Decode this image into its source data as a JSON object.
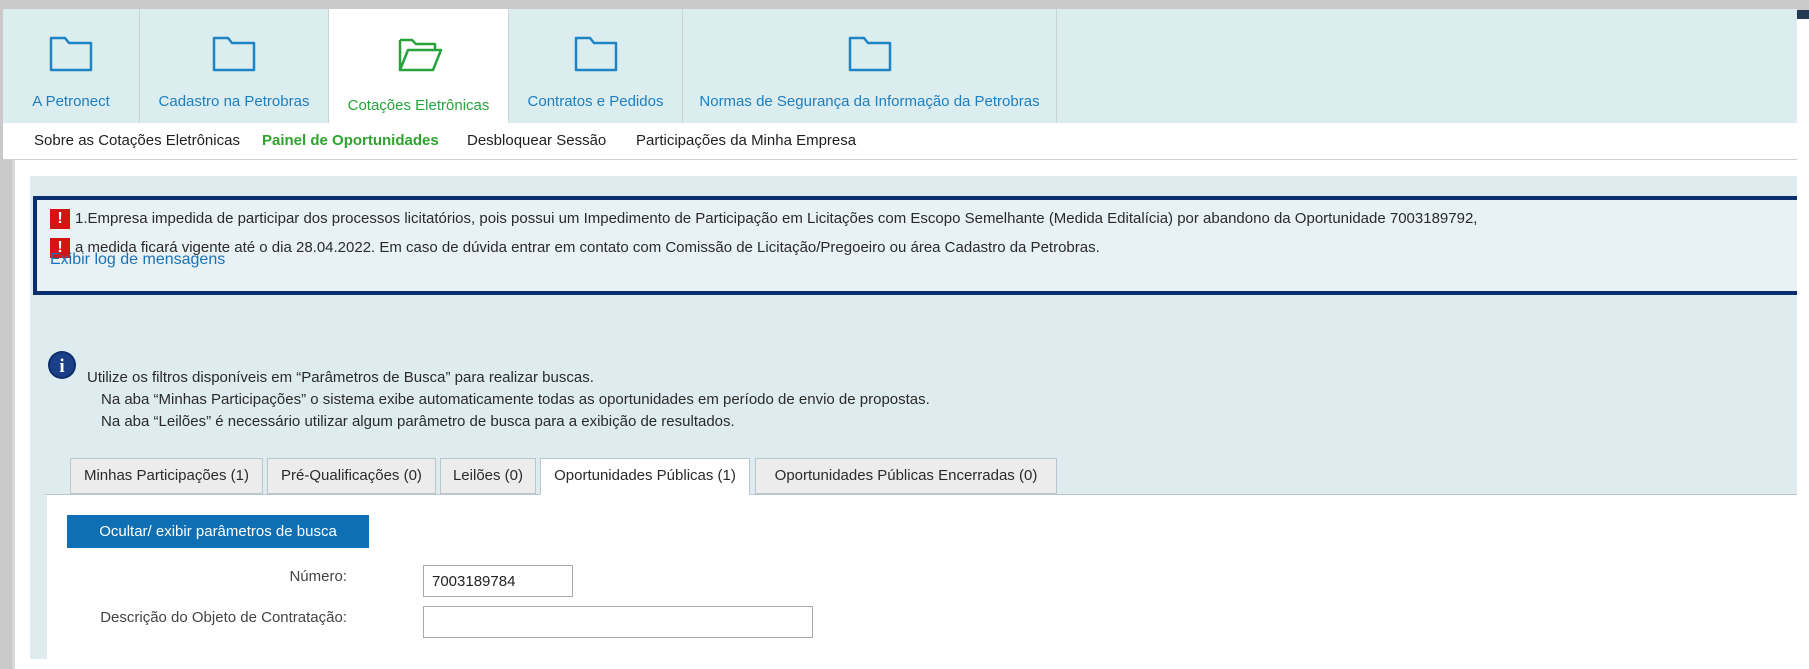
{
  "main_tabs": [
    {
      "label": "A Petronect",
      "icon": "folder-icon"
    },
    {
      "label": "Cadastro na Petrobras",
      "icon": "folder-icon"
    },
    {
      "label": "Cotações Eletrônicas",
      "icon": "folder-open-icon"
    },
    {
      "label": "Contratos e Pedidos",
      "icon": "folder-icon"
    },
    {
      "label": "Normas de Segurança da Informação da Petrobras",
      "icon": "folder-icon"
    }
  ],
  "sub_nav": [
    {
      "label": "Sobre as Cotações Eletrônicas"
    },
    {
      "label": "Painel de Oportunidades"
    },
    {
      "label": "Desbloquear Sessão"
    },
    {
      "label": "Participações da Minha Empresa"
    }
  ],
  "messages": {
    "lines": [
      "1.Empresa impedida de participar dos processos licitatórios, pois possui um Impedimento de Participação em Licitações com Escopo Semelhante (Medida Editalícia) por abandono da Oportunidade 7003189792,",
      "a medida ficará vigente até o dia 28.04.2022. Em caso de dúvida entrar em contato com Comissão de Licitação/Pregoeiro ou área Cadastro da Petrobras."
    ],
    "log_link": "Exibir log de mensagens",
    "error_glyph": "!"
  },
  "info": {
    "icon_glyph": "i",
    "lines": [
      "Utilize os filtros disponíveis em “Parâmetros de Busca” para realizar buscas.",
      "Na aba “Minhas Participações” o sistema exibe automaticamente todas as oportunidades em período de envio de propostas.",
      "Na aba “Leilões” é necessário utilizar algum parâmetro de busca para a exibição de resultados."
    ]
  },
  "inner_tabs": [
    {
      "label": "Minhas Participações (1)"
    },
    {
      "label": "Pré-Qualificações (0)"
    },
    {
      "label": "Leilões (0)"
    },
    {
      "label": "Oportunidades Públicas (1)"
    },
    {
      "label": "Oportunidades Públicas Encerradas (0)"
    }
  ],
  "search": {
    "toggle_label": "Ocultar/ exibir parâmetros de busca",
    "numero_label": "Número:",
    "numero_value": "7003189784",
    "descricao_label": "Descrição do Objeto de Contratação:",
    "descricao_value": ""
  },
  "colors": {
    "tab_link": "#1d7fbf",
    "active_green": "#27a33b",
    "error_red": "#d41313",
    "message_border": "#0b2e6e",
    "primary_button": "#0e6fb5"
  }
}
